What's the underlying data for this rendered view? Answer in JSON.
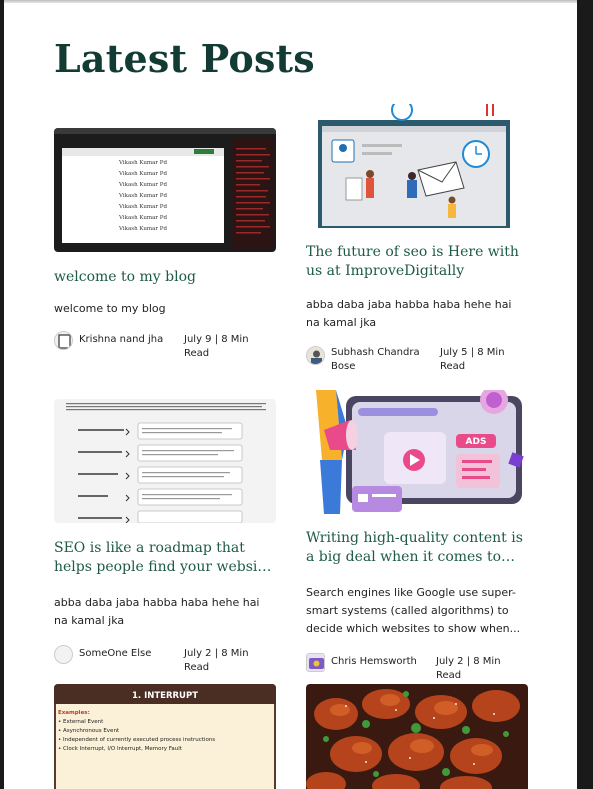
{
  "page": {
    "title": "Latest Posts"
  },
  "posts": [
    {
      "title": "welcome to my blog",
      "excerpt": "welcome to my blog",
      "author": "Krishna nand jha",
      "date": "July 9 | 8 Min Read",
      "thumb_text": [
        "Vikash Kumar Pd",
        "Vikash Kumar Pd",
        "Vikash Kumar Pd",
        "Vikash Kumar Pd",
        "Vikash Kumar Pd",
        "Vikash Kumar Pd",
        "Vikash Kumar Pd"
      ]
    },
    {
      "title": "The future of seo is Here with us at ImproveDigitally",
      "excerpt": "abba daba jaba habba haba hehe hai na kamal jka",
      "author": "Subhash Chandra Bose",
      "date": "July 5 | 8 Min Read"
    },
    {
      "title": "SEO is like a roadmap that helps people find your website. It's super...",
      "excerpt": "abba daba jaba habba haba hehe hai na kamal jka",
      "author": "SomeOne Else",
      "date": "July 2 | 8 Min Read"
    },
    {
      "title": "Writing high-quality content is a big deal when it comes to SEO. Yo...",
      "excerpt": "Search engines like Google use super-smart systems (called algorithms) to decide which websites to show when...",
      "author": "Chris Hemsworth",
      "date": "July 2 | 8 Min Read",
      "thumb_text": [
        "ADS"
      ]
    },
    {
      "thumb_text": [
        "1. INTERRUPT",
        "Examples:",
        "• External Event",
        "• Asynchronous Event",
        "• Independent of currently executed process instructions",
        "• Clock Interrupt, I/O Interrupt, Memory Fault"
      ]
    }
  ],
  "colors": {
    "title": "#123c33",
    "post_title": "#1d5a48",
    "ads_pink": "#e94b8a",
    "interrupt_header": "#5a3a2e"
  }
}
